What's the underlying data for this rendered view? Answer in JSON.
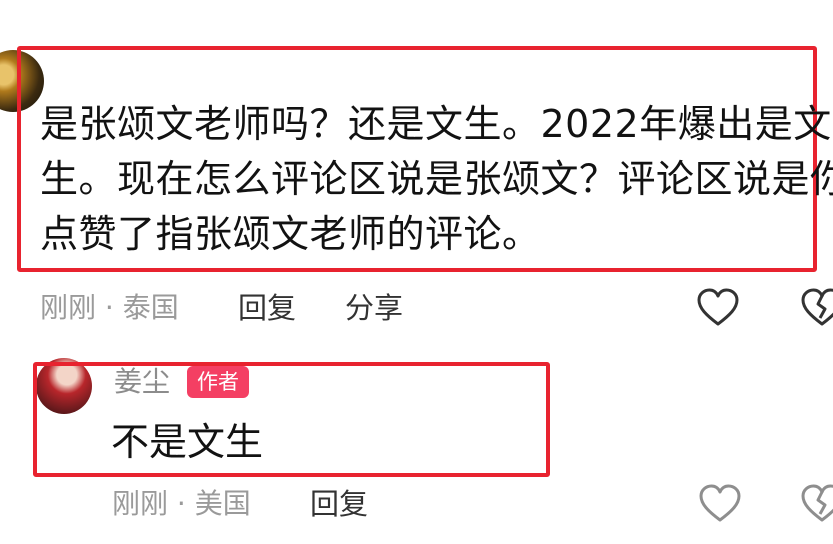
{
  "comment1": {
    "username": "",
    "lines": [
      "是张颂文老师吗？还是文生。2022年爆出是文",
      "生。现在怎么评论区说是张颂文？评论区说是你",
      "点赞了指张颂文老师的评论。"
    ],
    "time": "刚刚",
    "separator": "·",
    "location": "泰国",
    "reply_label": "回复",
    "share_label": "分享"
  },
  "comment2": {
    "username": "姜尘",
    "badge": "作者",
    "text": "不是文生",
    "time": "刚刚",
    "separator": "·",
    "location": "美国",
    "reply_label": "回复"
  },
  "colors": {
    "highlight_box": "#e8232f",
    "author_badge": "#f43f63",
    "meta_text": "#9a9a9a"
  },
  "icons": {
    "like": "heart-outline-icon",
    "dislike": "broken-heart-icon"
  }
}
